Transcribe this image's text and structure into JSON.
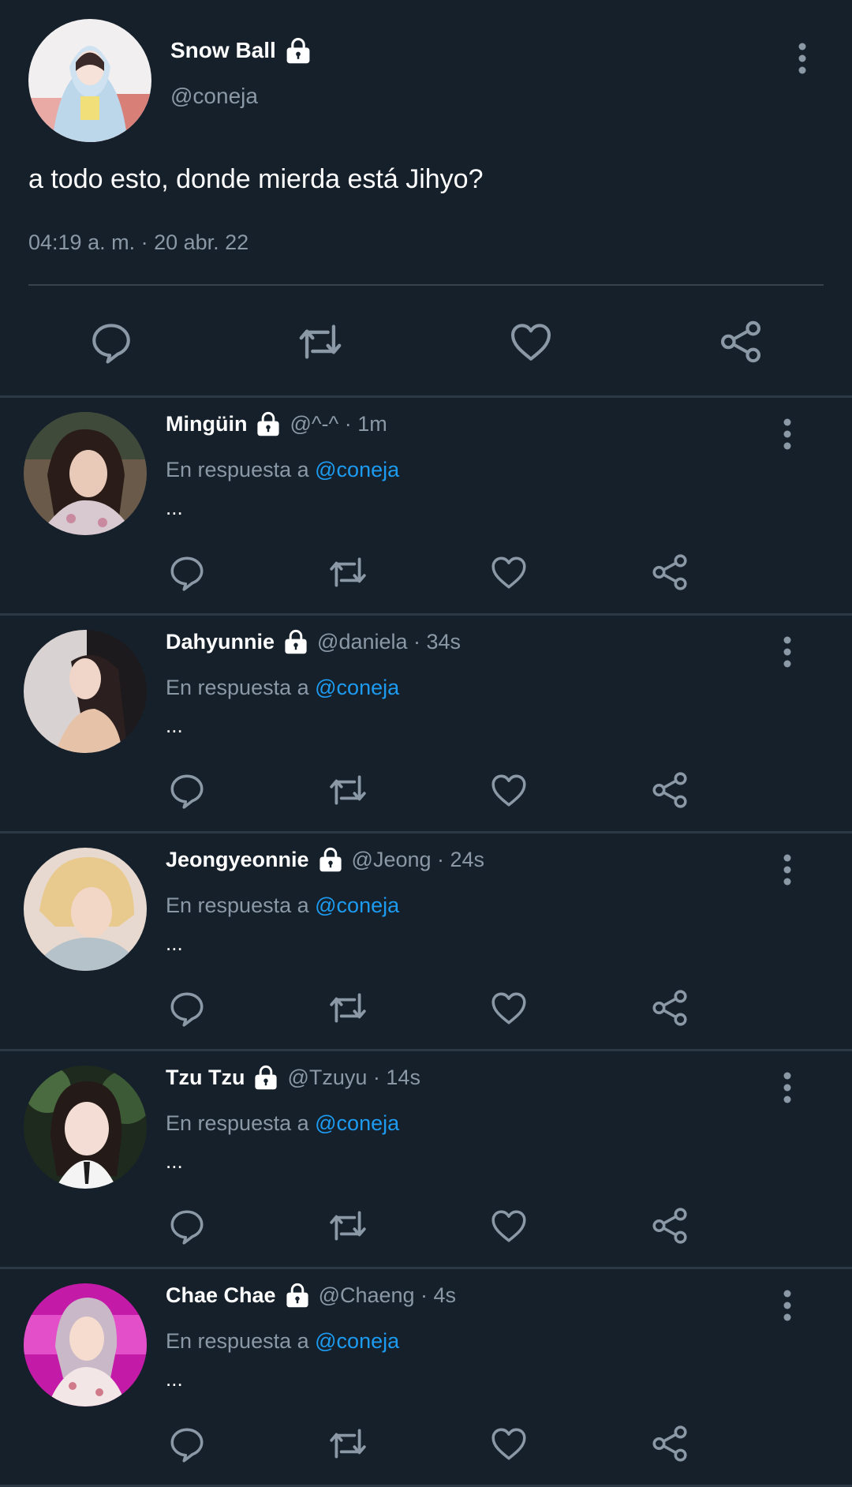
{
  "main_tweet": {
    "name": "Snow Ball",
    "handle": "@coneja",
    "text": "a todo esto, donde mierda está Jihyo?",
    "timestamp": "04:19 a. m. · 20 abr. 22",
    "icons": [
      "lock-icon",
      "more-icon",
      "reply-icon",
      "retweet-icon",
      "like-icon",
      "share-icon"
    ]
  },
  "replies": [
    {
      "name": "Mingüin",
      "meta": "@^-^ · 1m",
      "in_reply_label": "En respuesta a",
      "mention": "@coneja",
      "text": "..."
    },
    {
      "name": "Dahyunnie",
      "meta": "@daniela · 34s",
      "in_reply_label": "En respuesta a",
      "mention": "@coneja",
      "text": "..."
    },
    {
      "name": "Jeongyeonnie",
      "meta": "@Jeong · 24s",
      "in_reply_label": "En respuesta a",
      "mention": "@coneja",
      "text": "..."
    },
    {
      "name": "Tzu Tzu",
      "meta": "@Tzuyu · 14s",
      "in_reply_label": "En respuesta a",
      "mention": "@coneja",
      "text": "..."
    },
    {
      "name": "Chae Chae",
      "meta": "@Chaeng · 4s",
      "in_reply_label": "En respuesta a",
      "mention": "@coneja",
      "text": "..."
    }
  ],
  "colors": {
    "background": "#15202b",
    "secondary_text": "#8b98a5",
    "mention": "#1d9bf0",
    "divider": "#2c3844"
  }
}
